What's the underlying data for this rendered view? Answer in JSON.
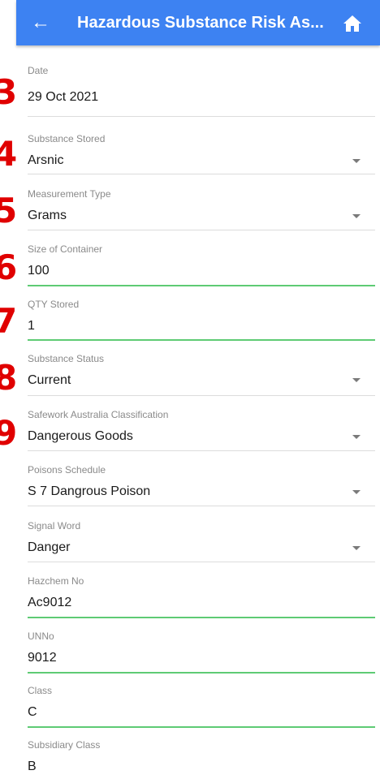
{
  "header": {
    "title": "Hazardous Substance Risk As...",
    "back_icon": "arrow-left-icon",
    "home_icon": "home-icon",
    "color": "#3d82f2"
  },
  "annotations": [
    "3",
    "4",
    "5",
    "6",
    "7",
    "8",
    "9"
  ],
  "fields": {
    "date": {
      "label": "Date",
      "value": "29 Oct 2021"
    },
    "substance_stored": {
      "label": "Substance Stored",
      "value": "Arsnic"
    },
    "measurement_type": {
      "label": "Measurement Type",
      "value": "Grams"
    },
    "size_of_container": {
      "label": "Size of Container",
      "value": "100"
    },
    "qty_stored": {
      "label": "QTY Stored",
      "value": "1"
    },
    "substance_status": {
      "label": "Substance Status",
      "value": "Current"
    },
    "safework_classification": {
      "label": "Safework Australia Classification",
      "value": "Dangerous Goods"
    },
    "poisons_schedule": {
      "label": "Poisons Schedule",
      "value": "S 7 Dangrous Poison"
    },
    "signal_word": {
      "label": "Signal Word",
      "value": "Danger"
    },
    "hazchem_no": {
      "label": "Hazchem No",
      "value": "Ac9012"
    },
    "un_no": {
      "label": "UNNo",
      "value": "9012"
    },
    "class": {
      "label": "Class",
      "value": "C"
    },
    "subsidiary_class": {
      "label": "Subsidiary Class",
      "value": "B"
    }
  },
  "colors": {
    "input_underline": "#5ecb74",
    "annotation": "#e00000"
  }
}
